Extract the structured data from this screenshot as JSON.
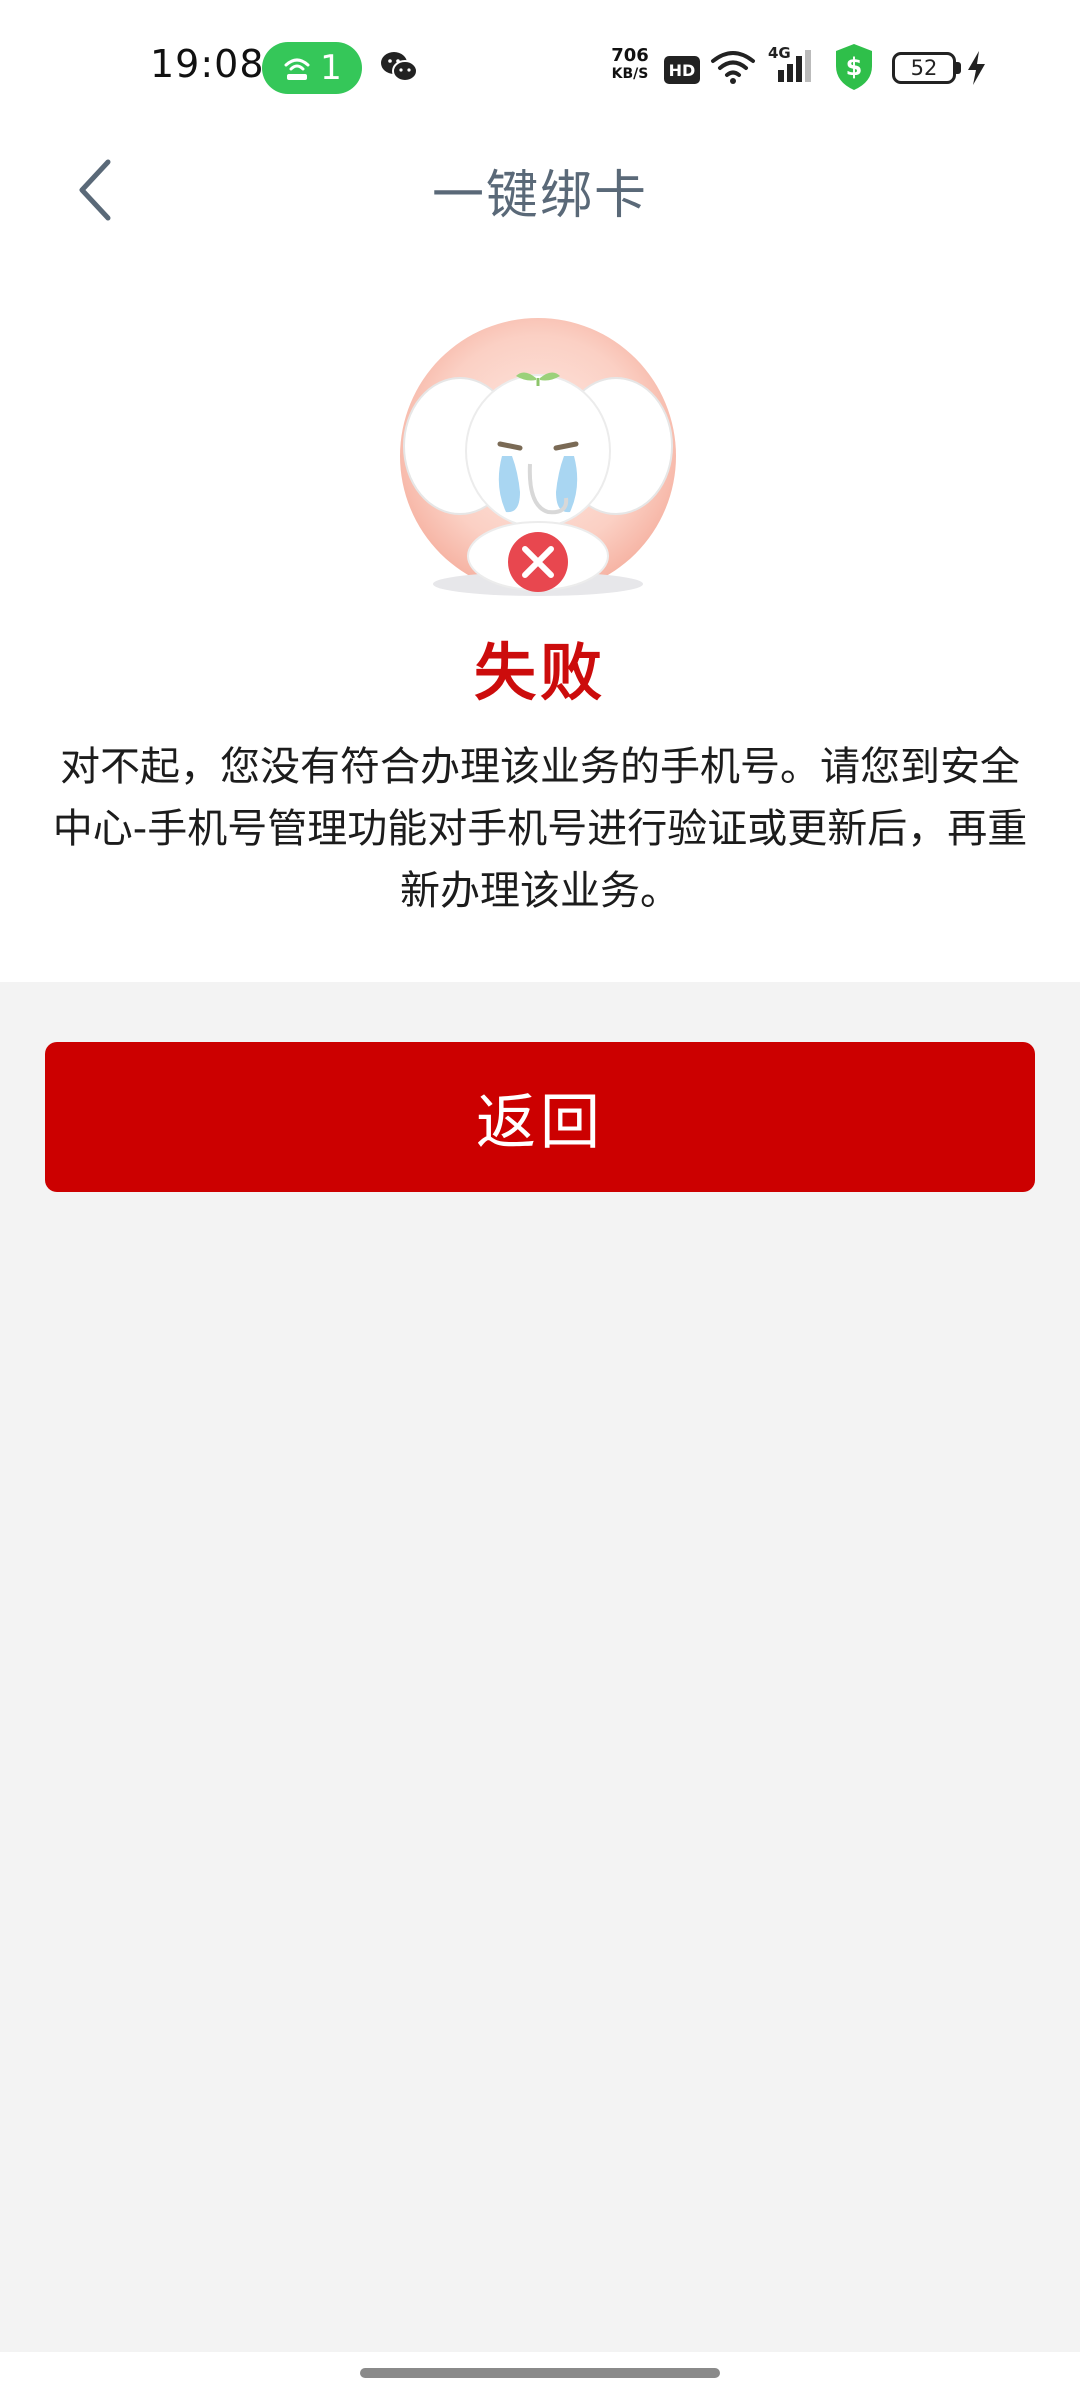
{
  "status_bar": {
    "time": "19:08",
    "hotspot_count": "1",
    "net_speed_value": "706",
    "net_speed_unit": "KB/S",
    "hd_label": "HD",
    "signal_label": "4G",
    "battery": "52",
    "icons": [
      "hotspot-icon",
      "wechat-icon",
      "wifi-icon",
      "signal-icon",
      "shield-icon",
      "battery-icon",
      "charging-icon"
    ]
  },
  "header": {
    "title": "一键绑卡",
    "back_icon": "chevron-left-icon"
  },
  "result": {
    "status": "失败",
    "message": "对不起，您没有符合办理该业务的手机号。请您到安全中心-手机号管理功能对手机号进行验证或更新后，再重新办理该业务。",
    "mascot_icon": "crying-elephant-icon"
  },
  "actions": {
    "return_label": "返回"
  },
  "colors": {
    "accent": "#cc0000",
    "title_text": "#5a6978",
    "background": "#f3f3f3"
  }
}
